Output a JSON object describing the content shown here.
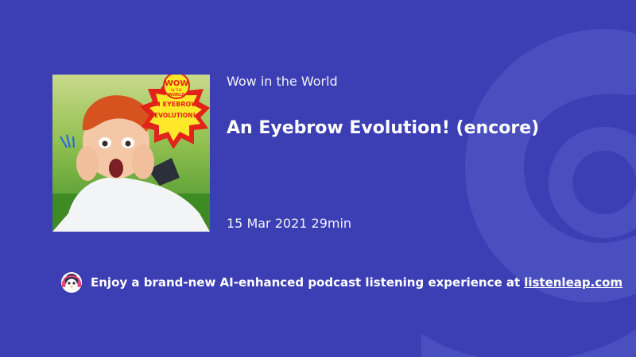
{
  "podcast": {
    "show_name": "Wow in the World",
    "episode_title": "An Eyebrow Evolution! (encore)",
    "date": "15 Mar 2021",
    "duration": "29min",
    "cover_art": {
      "badge_top": "WOW",
      "badge_small": "IN THE",
      "badge_bottom": "WORLD",
      "burst_line1": "AN EYEBROW",
      "burst_line2": "EVOLUTION!"
    }
  },
  "promo": {
    "text": "Enjoy a brand-new AI-enhanced podcast listening experience at",
    "link_text": "listenleap.com"
  },
  "colors": {
    "background": "#3c3fb4",
    "watermark": "#4a4fc0",
    "text": "#ffffff",
    "burst_yellow": "#ffe82a",
    "burst_red": "#e2231a"
  },
  "icons": {
    "background": "listenleap-logo-watermark",
    "mascot": "penguin-headphones-icon"
  }
}
